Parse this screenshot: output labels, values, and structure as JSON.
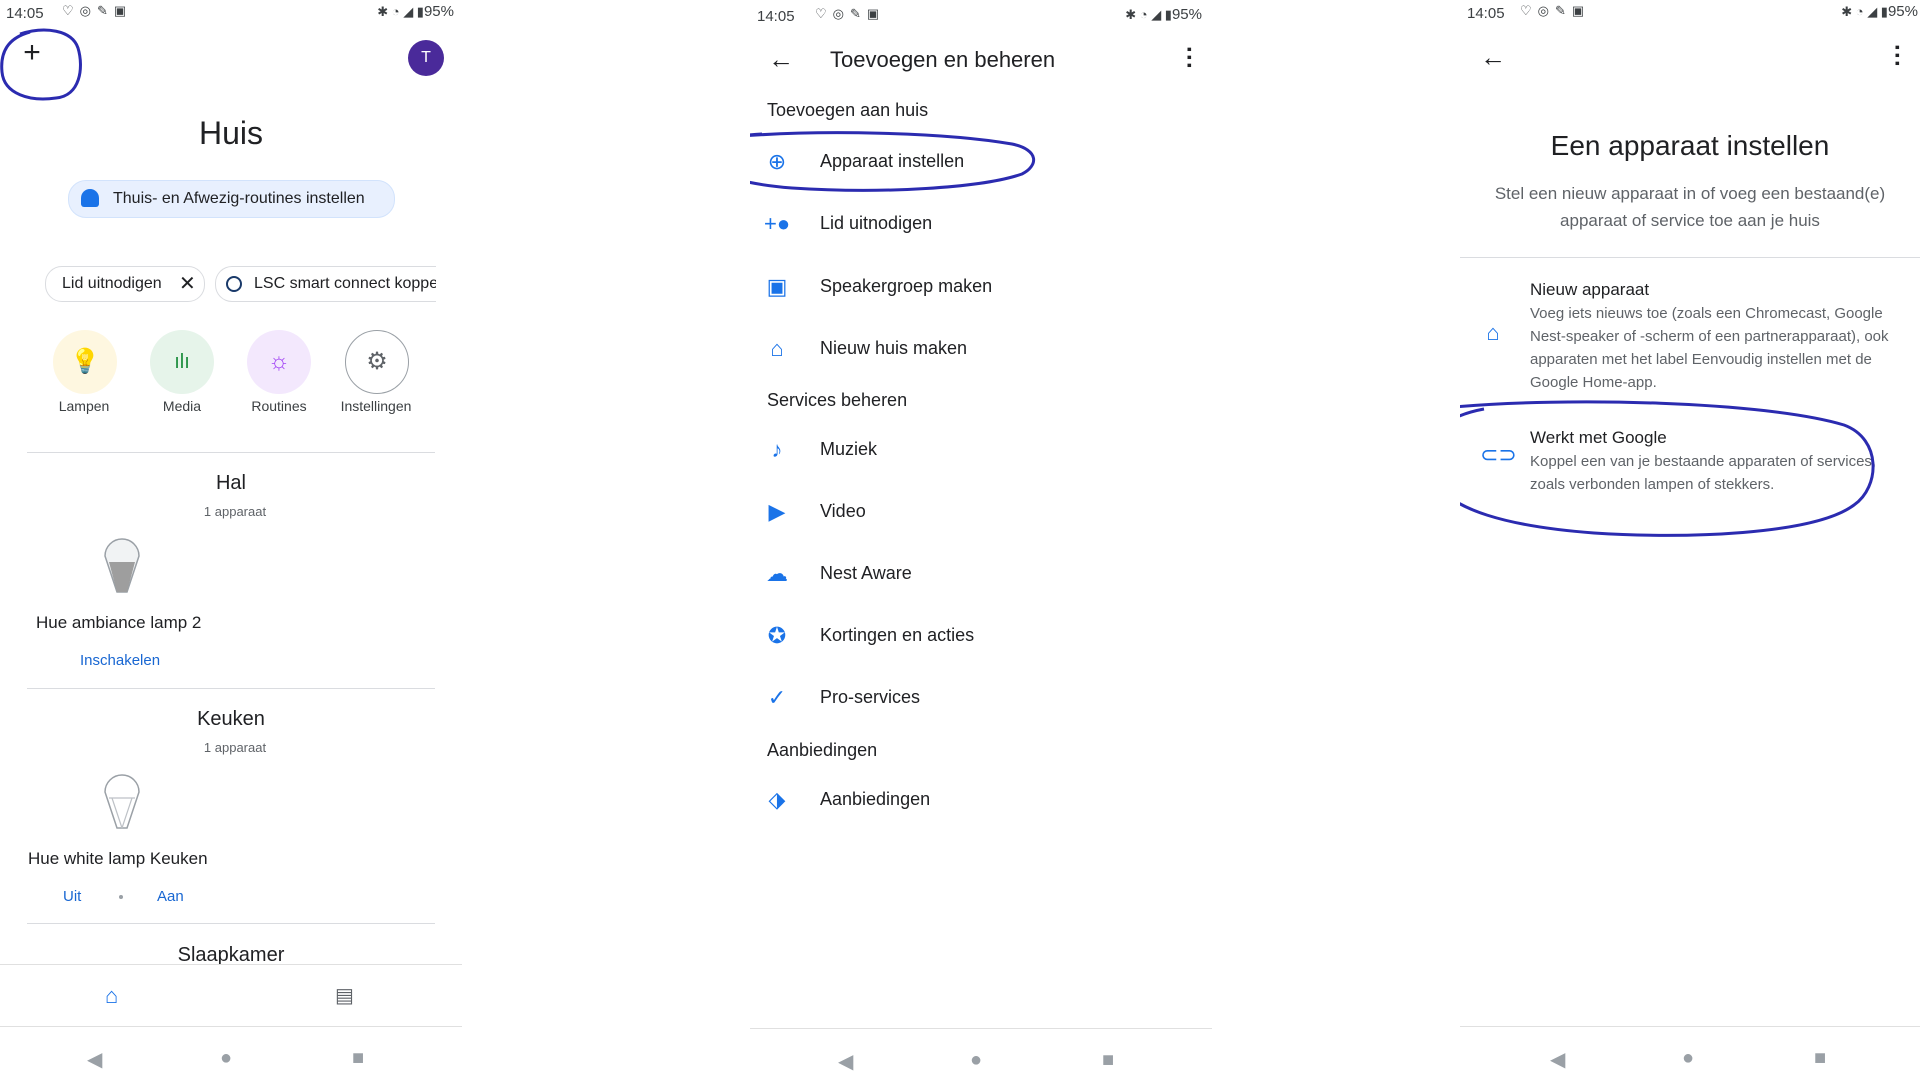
{
  "status_bar": {
    "time": "14:05",
    "battery_p1": "95%",
    "battery_p2": "95%",
    "battery_p3": "95%"
  },
  "panel_home": {
    "title": "Huis",
    "avatar_letter": "T",
    "routine_chip": "Thuis- en Afwezig-routines instellen",
    "chips": [
      "Lid uitnodigen",
      "LSC smart connect koppe"
    ],
    "favorites": [
      {
        "label": "Lampen",
        "icon": "lightbulb-icon",
        "bg": "#fef7e0"
      },
      {
        "label": "Media",
        "icon": "media-bars-icon",
        "bg": "#e6f4ea"
      },
      {
        "label": "Routines",
        "icon": "routines-icon",
        "bg": "#f3e8fd"
      },
      {
        "label": "Instellingen",
        "icon": "gear-icon",
        "bg": "#ffffff"
      }
    ],
    "rooms": [
      {
        "name": "Hal",
        "count": "1 apparaat",
        "device": "Hue ambiance lamp 2",
        "actions": [
          "Inschakelen"
        ]
      },
      {
        "name": "Keuken",
        "count": "1 apparaat",
        "device": "Hue white lamp Keuken",
        "actions": [
          "Uit",
          "Aan"
        ]
      },
      {
        "name": "Slaapkamer"
      }
    ]
  },
  "panel_manage": {
    "title": "Toevoegen en beheren",
    "section_add": "Toevoegen aan huis",
    "add_items": [
      {
        "label": "Apparaat instellen",
        "icon": "add-circle-icon"
      },
      {
        "label": "Lid uitnodigen",
        "icon": "person-add-icon"
      },
      {
        "label": "Speakergroep maken",
        "icon": "speaker-group-icon"
      },
      {
        "label": "Nieuw huis maken",
        "icon": "home-icon"
      }
    ],
    "section_services": "Services beheren",
    "service_items": [
      {
        "label": "Muziek",
        "icon": "music-note-icon"
      },
      {
        "label": "Video",
        "icon": "video-icon"
      },
      {
        "label": "Nest Aware",
        "icon": "nest-aware-icon"
      },
      {
        "label": "Kortingen en acties",
        "icon": "discount-icon"
      },
      {
        "label": "Pro-services",
        "icon": "pro-services-icon"
      }
    ],
    "section_offers": "Aanbiedingen",
    "offer_items": [
      {
        "label": "Aanbiedingen",
        "icon": "tag-icon"
      }
    ]
  },
  "panel_setup": {
    "title": "Een apparaat instellen",
    "subtitle": "Stel een nieuw apparaat in of voeg een bestaand(e) apparaat of service toe aan je huis",
    "options": [
      {
        "title": "Nieuw apparaat",
        "desc": "Voeg iets nieuws toe (zoals een Chromecast, Google Nest-speaker of -scherm of een partnerapparaat), ook apparaten met het label Eenvoudig instellen met de Google Home-app.",
        "icon": "home-icon"
      },
      {
        "title": "Werkt met Google",
        "desc": "Koppel een van je bestaande apparaten of services, zoals verbonden lampen of stekkers.",
        "icon": "link-icon"
      }
    ]
  },
  "colors": {
    "accent": "#1a73e8",
    "annotation": "#2b2bb0",
    "avatar": "#4a2a9a"
  }
}
